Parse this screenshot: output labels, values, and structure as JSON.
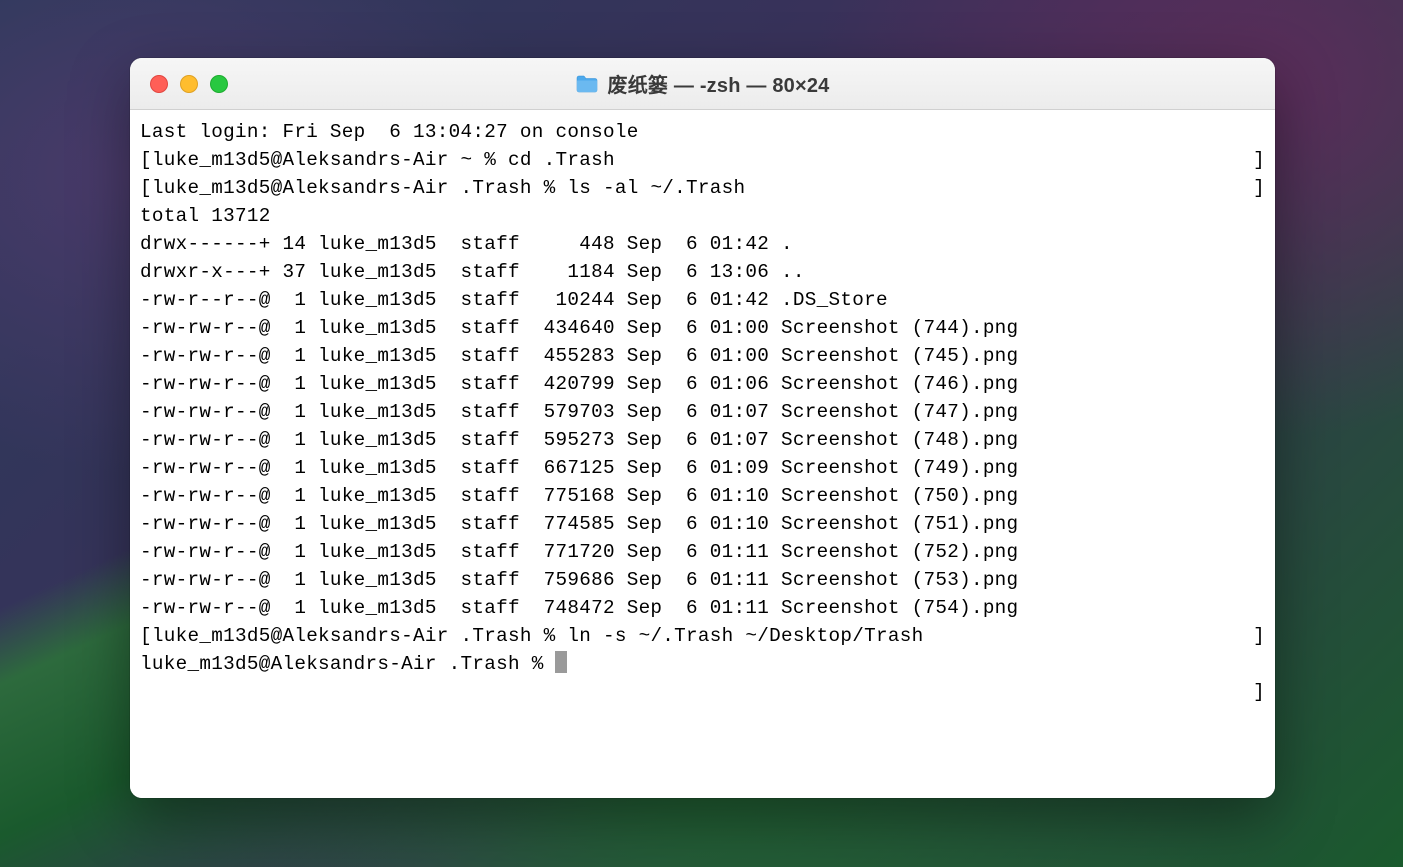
{
  "window": {
    "title": "废纸篓 — -zsh — 80×24"
  },
  "terminal": {
    "last_login": "Last login: Fri Sep  6 13:04:27 on console",
    "prompt1_left": "[luke_m13d5@Aleksandrs-Air ~ % ",
    "cmd1": "cd .Trash",
    "prompt1_right": "]",
    "prompt2_left": "[luke_m13d5@Aleksandrs-Air .Trash % ",
    "cmd2": "ls -al ~/.Trash",
    "prompt2_right": "]",
    "total": "total 13712",
    "rows": [
      "drwx------+ 14 luke_m13d5  staff     448 Sep  6 01:42 .",
      "drwxr-x---+ 37 luke_m13d5  staff    1184 Sep  6 13:06 ..",
      "-rw-r--r--@  1 luke_m13d5  staff   10244 Sep  6 01:42 .DS_Store",
      "-rw-rw-r--@  1 luke_m13d5  staff  434640 Sep  6 01:00 Screenshot (744).png",
      "-rw-rw-r--@  1 luke_m13d5  staff  455283 Sep  6 01:00 Screenshot (745).png",
      "-rw-rw-r--@  1 luke_m13d5  staff  420799 Sep  6 01:06 Screenshot (746).png",
      "-rw-rw-r--@  1 luke_m13d5  staff  579703 Sep  6 01:07 Screenshot (747).png",
      "-rw-rw-r--@  1 luke_m13d5  staff  595273 Sep  6 01:07 Screenshot (748).png",
      "-rw-rw-r--@  1 luke_m13d5  staff  667125 Sep  6 01:09 Screenshot (749).png",
      "-rw-rw-r--@  1 luke_m13d5  staff  775168 Sep  6 01:10 Screenshot (750).png",
      "-rw-rw-r--@  1 luke_m13d5  staff  774585 Sep  6 01:10 Screenshot (751).png",
      "-rw-rw-r--@  1 luke_m13d5  staff  771720 Sep  6 01:11 Screenshot (752).png",
      "-rw-rw-r--@  1 luke_m13d5  staff  759686 Sep  6 01:11 Screenshot (753).png",
      "-rw-rw-r--@  1 luke_m13d5  staff  748472 Sep  6 01:11 Screenshot (754).png"
    ],
    "prompt3_left": "[luke_m13d5@Aleksandrs-Air .Trash % ",
    "cmd3": "ln -s ~/.Trash ~/Desktop/Trash",
    "prompt3_right": "]",
    "prompt4": "luke_m13d5@Aleksandrs-Air .Trash % ",
    "prompt4_right": "]"
  }
}
